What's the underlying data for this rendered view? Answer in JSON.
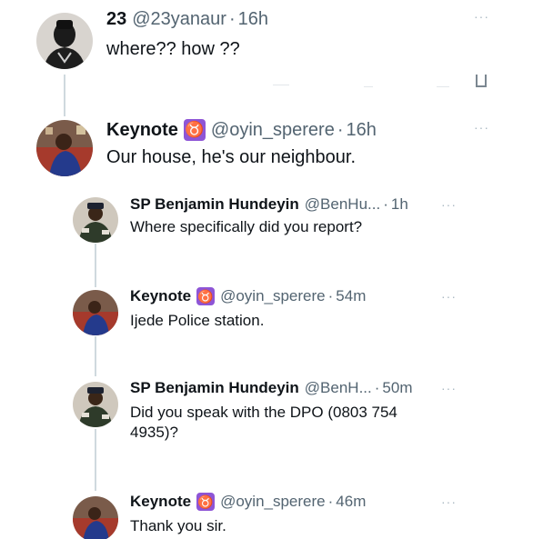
{
  "tweets": [
    {
      "name": "23",
      "handle": "@23yanaur",
      "dot": "·",
      "time": "16h",
      "text": "where?? how ??",
      "more": "···",
      "avatar_icon": "avatar-photo"
    },
    {
      "name": "Keynote",
      "badge": "♉",
      "handle": "@oyin_sperere",
      "dot": "·",
      "time": "16h",
      "text": "Our house, he's our neighbour.",
      "more": "···",
      "avatar_icon": "avatar-photo"
    },
    {
      "name": "SP Benjamin Hundeyin",
      "handle": "@BenHu...",
      "dot": "·",
      "time": "1h",
      "text": "Where specifically did you report?",
      "more": "···",
      "avatar_icon": "avatar-photo"
    },
    {
      "name": "Keynote",
      "badge": "♉",
      "handle": "@oyin_sperere",
      "dot": "·",
      "time": "54m",
      "text": "Ijede Police station.",
      "more": "···",
      "avatar_icon": "avatar-photo"
    },
    {
      "name": "SP Benjamin Hundeyin",
      "handle": "@BenH...",
      "dot": "·",
      "time": "50m",
      "text": "Did you speak with the DPO (0803 754 4935)?",
      "more": "···",
      "avatar_icon": "avatar-photo"
    },
    {
      "name": "Keynote",
      "badge": "♉",
      "handle": "@oyin_sperere",
      "dot": "·",
      "time": "46m",
      "text": "Thank you sir.",
      "more": "···",
      "avatar_icon": "avatar-photo"
    }
  ],
  "colors": {
    "badge": "#8e55d6",
    "thread_line": "#cfd9de",
    "secondary_text": "#536471"
  }
}
